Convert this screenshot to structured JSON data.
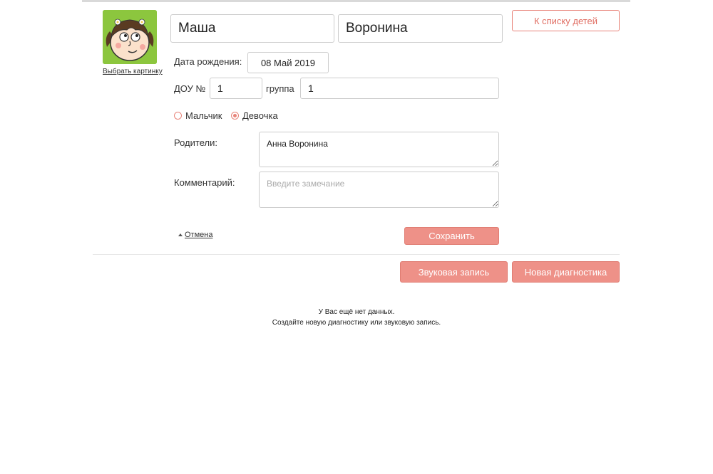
{
  "avatar": {
    "icon": "girl-avatar-icon",
    "background": "#8cc63e",
    "choose_label": "Выбрать картинку"
  },
  "child": {
    "first_name": "Маша",
    "last_name": "Воронина"
  },
  "back_button": "К списку детей",
  "birth": {
    "label": "Дата рождения:",
    "value": "08 Май 2019"
  },
  "dou": {
    "label": "ДОУ №",
    "value": "1",
    "group_label": "группа",
    "group_value": "1"
  },
  "gender": {
    "options": [
      {
        "label": "Мальчик",
        "checked": false
      },
      {
        "label": "Девочка",
        "checked": true
      }
    ]
  },
  "parents": {
    "label": "Родители:",
    "value": "Анна Воронина"
  },
  "comment": {
    "label": "Комментарий:",
    "placeholder": "Введите замечание",
    "value": ""
  },
  "actions": {
    "cancel": "Отмена",
    "save": "Сохранить"
  },
  "records": {
    "audio_button": "Звуковая запись",
    "new_diagnostics_button": "Новая диагностика",
    "empty_line1": "У Вас ещё нет данных.",
    "empty_line2": "Создайте новую диагностику или звуковую запись."
  },
  "colors": {
    "accent": "#ee9188",
    "accent_border": "#e8847a",
    "avatar_bg": "#8cc63e"
  }
}
